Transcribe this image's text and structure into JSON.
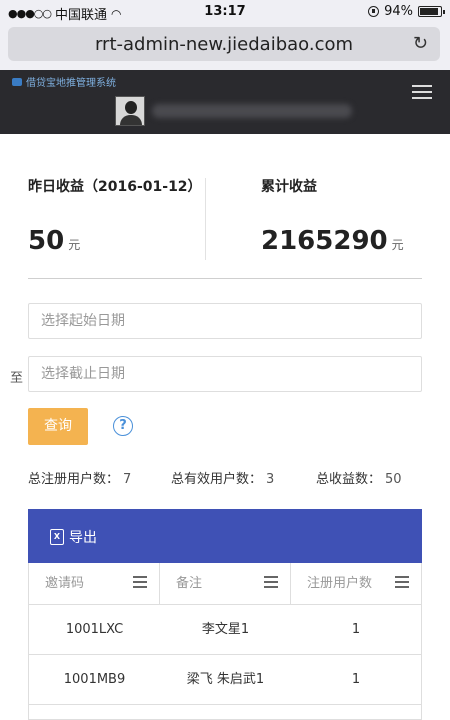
{
  "status_bar": {
    "carrier": "中国联通",
    "time": "13:17",
    "battery": "94%"
  },
  "browser": {
    "url": "rrt-admin-new.jiedaibao.com"
  },
  "app": {
    "logo_text": "借贷宝地推管理系统"
  },
  "stats": {
    "yesterday_label": "昨日收益（2016-01-12）",
    "yesterday_value": "50",
    "yesterday_unit": "元",
    "total_label": "累计收益",
    "total_value": "2165290",
    "total_unit": "元"
  },
  "filters": {
    "start_placeholder": "选择起始日期",
    "end_placeholder": "选择截止日期",
    "to_label": "至",
    "query_label": "查询"
  },
  "summary": {
    "registered_label": "总注册用户数：",
    "registered_value": "7",
    "active_label": "总有效用户数：",
    "active_value": "3",
    "earnings_label": "总收益数：",
    "earnings_value": "50"
  },
  "table": {
    "export_label": "导出",
    "columns": [
      "邀请码",
      "备注",
      "注册用户数"
    ],
    "rows": [
      [
        "1001LXC",
        "李文星1",
        "1"
      ],
      [
        "1001MB9",
        "梁飞 朱启武1",
        "1"
      ]
    ]
  }
}
